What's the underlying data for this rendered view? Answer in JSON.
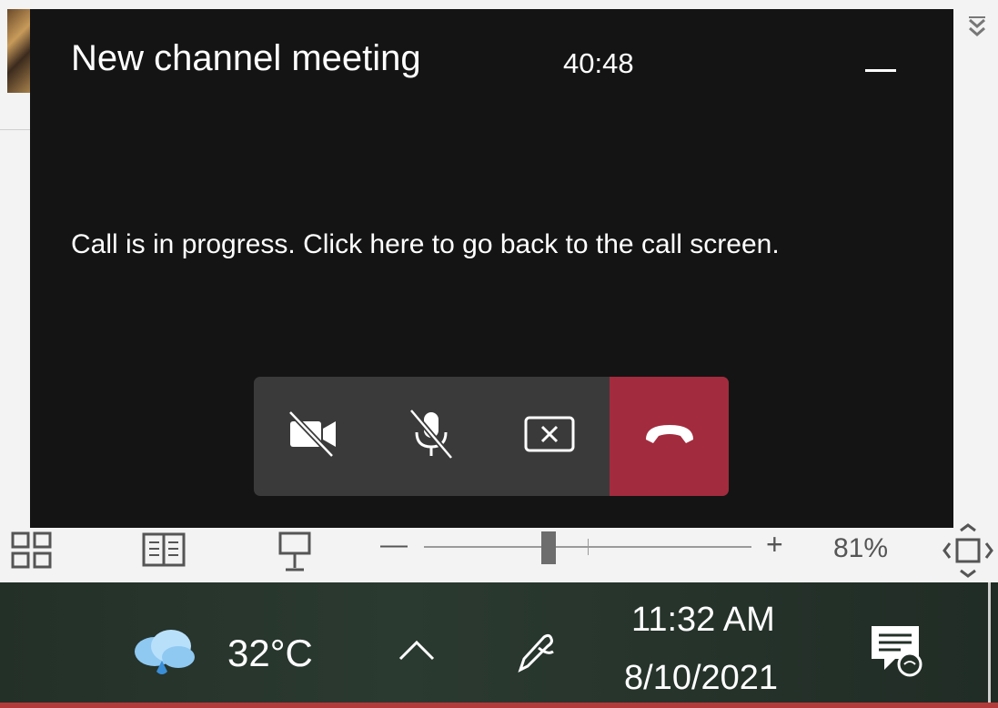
{
  "meeting": {
    "title": "New channel meeting",
    "timer": "40:48",
    "message": "Call is in progress. Click here to go back to the call screen.",
    "controls": [
      {
        "icon": "camera-off-icon",
        "name": "camera-toggle-button"
      },
      {
        "icon": "mic-off-icon",
        "name": "mic-toggle-button"
      },
      {
        "icon": "stop-share-icon",
        "name": "stop-sharing-button"
      },
      {
        "icon": "hang-up-icon",
        "name": "hang-up-button"
      }
    ],
    "colors": {
      "background": "#141414",
      "controls": "#3a3a3a",
      "hangup": "#a32b3e"
    }
  },
  "statusbar": {
    "zoom_minus": "—",
    "zoom_plus": "+",
    "zoom_percent": "81%",
    "zoom_value": 0.38
  },
  "taskbar": {
    "temperature": "32°C",
    "time": "11:32 AM",
    "date": "8/10/2021"
  }
}
